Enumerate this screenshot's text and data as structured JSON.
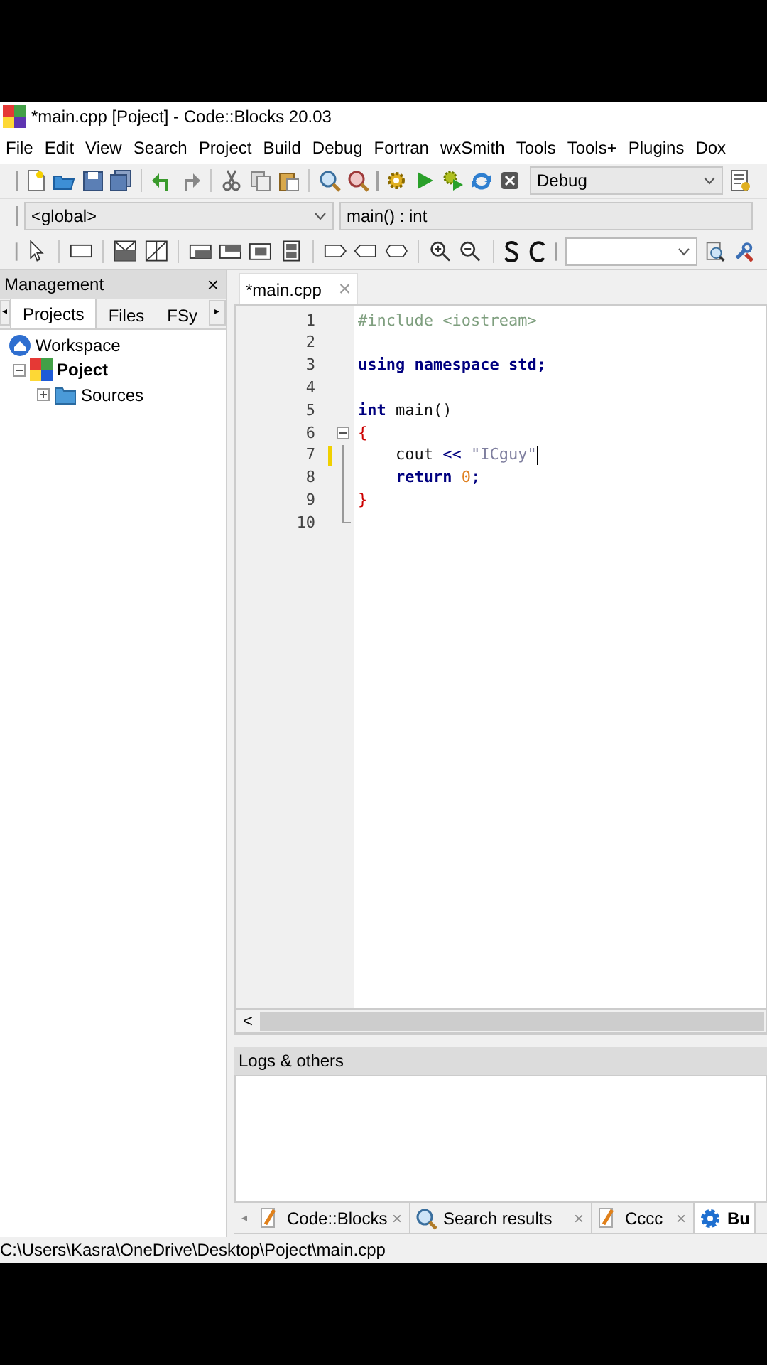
{
  "window": {
    "title": "*main.cpp [Poject] - Code::Blocks 20.03"
  },
  "menu": [
    "File",
    "Edit",
    "View",
    "Search",
    "Project",
    "Build",
    "Debug",
    "Fortran",
    "wxSmith",
    "Tools",
    "Tools+",
    "Plugins",
    "Dox"
  ],
  "build_target": {
    "value": "Debug"
  },
  "code_completion": {
    "scope": "<global>",
    "symbol": "main() : int"
  },
  "management": {
    "title": "Management",
    "close": "×",
    "scroll_left": "◂",
    "scroll_right": "▸",
    "tabs": [
      {
        "label": "Projects",
        "selected": true
      },
      {
        "label": "Files",
        "selected": false
      },
      {
        "label": "FSy",
        "selected": false
      }
    ],
    "tree": [
      {
        "label": "Workspace",
        "kind": "workspace",
        "children": [
          {
            "label": "Poject",
            "kind": "project",
            "active": true,
            "expanded": true,
            "children": [
              {
                "label": "Sources",
                "kind": "folder",
                "active": false,
                "expanded": false
              }
            ]
          }
        ]
      }
    ]
  },
  "editor": {
    "tabs": [
      {
        "label": "*main.cpp",
        "close": "×",
        "selected": true
      }
    ],
    "lines": [
      {
        "number": "1",
        "modified": false,
        "kind": "plain",
        "tokens": [
          {
            "text": "#include <iostream>",
            "kind": "preproc"
          }
        ]
      },
      {
        "number": "2",
        "modified": false,
        "kind": "plain"
      },
      {
        "number": "3",
        "modified": false,
        "kind": "plain",
        "tokens": [
          {
            "text": "using namespace std;",
            "kind": "keyword"
          }
        ]
      },
      {
        "number": "4",
        "modified": false,
        "kind": "plain"
      },
      {
        "number": "5",
        "modified": false,
        "kind": "plain",
        "tokens": [
          {
            "text": "int",
            "kind": "keyword"
          },
          {
            "text": " main()",
            "kind": "plain"
          }
        ]
      },
      {
        "number": "6",
        "modified": false,
        "kind": "fold-start",
        "tokens": [
          {
            "text": "{",
            "kind": "brace"
          }
        ]
      },
      {
        "number": "7",
        "modified": true,
        "kind": "fold-body",
        "cursor": true,
        "tokens": [
          {
            "text": "    cout ",
            "kind": "plain"
          },
          {
            "text": "<<",
            "kind": "operator"
          },
          {
            "text": " \"ICguy\"",
            "kind": "string"
          }
        ]
      },
      {
        "number": "8",
        "modified": false,
        "kind": "fold-body",
        "tokens": [
          {
            "text": "    return",
            "kind": "keyword"
          },
          {
            "text": " 0",
            "kind": "number"
          },
          {
            "text": ";",
            "kind": "operator"
          }
        ]
      },
      {
        "number": "9",
        "modified": false,
        "kind": "fold-body",
        "tokens": [
          {
            "text": "}",
            "kind": "brace"
          }
        ]
      },
      {
        "number": "10",
        "modified": false,
        "kind": "fold-end"
      }
    ],
    "scroll_left": "<"
  },
  "logs": {
    "title": "Logs & others",
    "scroll_left": "◂",
    "tabs": [
      {
        "label": "Code::Blocks",
        "kind": "log",
        "close": "×",
        "selected": false
      },
      {
        "label": "Search results",
        "kind": "search",
        "close": "×",
        "selected": false
      },
      {
        "label": "Cccc",
        "kind": "log",
        "close": "×",
        "selected": false
      },
      {
        "label": "Bu",
        "kind": "build",
        "selected": true
      }
    ]
  },
  "status_bar": {
    "path": "C:\\Users\\Kasra\\OneDrive\\Desktop\\Poject\\main.cpp"
  }
}
